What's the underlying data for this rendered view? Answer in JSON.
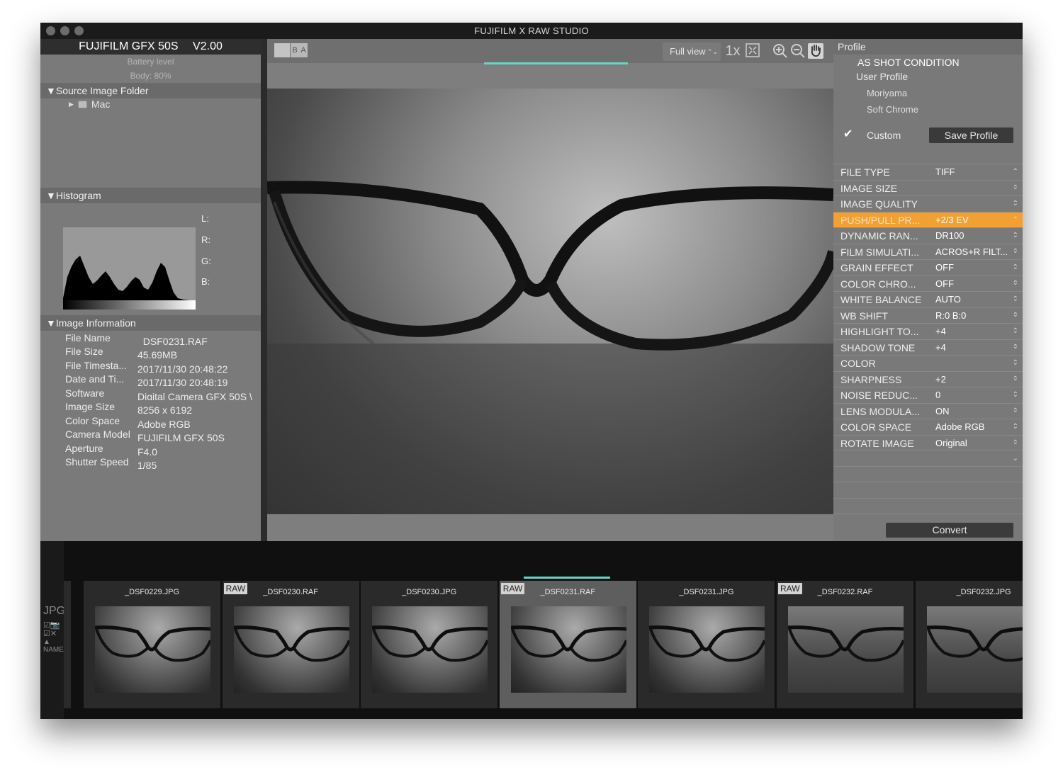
{
  "window": {
    "title": "FUJIFILM X RAW STUDIO"
  },
  "camera": {
    "model": "FUJIFILM GFX 50S",
    "version": "V2.00",
    "battery_label": "Battery level",
    "battery_body": "Body: 80%"
  },
  "source": {
    "header": "▼Source Image Folder",
    "item": "Mac"
  },
  "histogram": {
    "header": "▼Histogram",
    "labels": [
      "L:",
      "R:",
      "G:",
      "B:"
    ]
  },
  "info": {
    "header": "▼Image Information",
    "rows": [
      {
        "k": "File Name",
        "v": "_DSF0231.RAF"
      },
      {
        "k": "File Size",
        "v": "45.69MB"
      },
      {
        "k": "File Timesta...",
        "v": "2017/11/30 20:48:22"
      },
      {
        "k": "Date and Ti...",
        "v": "2017/11/30 20:48:19"
      },
      {
        "k": "Software",
        "v": "Digital Camera GFX 50S \\"
      },
      {
        "k": "Image Size",
        "v": "8256 x 6192"
      },
      {
        "k": "Color Space",
        "v": "Adobe RGB"
      },
      {
        "k": "Camera Model",
        "v": "FUJIFILM GFX 50S"
      },
      {
        "k": "Aperture",
        "v": "F4.0"
      },
      {
        "k": "Shutter Speed",
        "v": "1/85"
      }
    ]
  },
  "viewer": {
    "ba_b": "B",
    "ba_a": "A",
    "view_mode": "Full view",
    "zoom": "1x",
    "progress": 0.2
  },
  "profile": {
    "header": "Profile",
    "as_shot": "AS SHOT CONDITION",
    "user_profile": "User Profile",
    "items": [
      "Moriyama",
      "Soft Chrome"
    ],
    "custom": "Custom",
    "save_label": "Save Profile"
  },
  "settings": [
    {
      "k": "FILE TYPE",
      "v": "TIFF"
    },
    {
      "k": "IMAGE SIZE",
      "v": ""
    },
    {
      "k": "IMAGE QUALITY",
      "v": ""
    },
    {
      "k": "PUSH/PULL PR...",
      "v": "+2/3 EV"
    },
    {
      "k": "DYNAMIC RAN...",
      "v": "DR100"
    },
    {
      "k": "FILM SIMULATI...",
      "v": "ACROS+R FILT..."
    },
    {
      "k": "GRAIN EFFECT",
      "v": "OFF"
    },
    {
      "k": "COLOR CHRO...",
      "v": "OFF"
    },
    {
      "k": "WHITE BALANCE",
      "v": "AUTO"
    },
    {
      "k": "WB SHIFT",
      "v": "R:0 B:0"
    },
    {
      "k": "HIGHLIGHT TO...",
      "v": "+4"
    },
    {
      "k": "SHADOW TONE",
      "v": "+4"
    },
    {
      "k": "COLOR",
      "v": ""
    },
    {
      "k": "SHARPNESS",
      "v": "+2"
    },
    {
      "k": "NOISE REDUC...",
      "v": "0"
    },
    {
      "k": "LENS MODULA...",
      "v": "ON"
    },
    {
      "k": "COLOR SPACE",
      "v": "Adobe RGB"
    },
    {
      "k": "ROTATE IMAGE",
      "v": "Original"
    }
  ],
  "convert_label": "Convert",
  "filmstrip": {
    "side": {
      "jpg": "JPG",
      "name": "NAME"
    },
    "raw_badge": "RAW",
    "thumbs": [
      {
        "name": "_DSF0229.JPG",
        "raw": false
      },
      {
        "name": "_DSF0230.RAF",
        "raw": true
      },
      {
        "name": "_DSF0230.JPG",
        "raw": false
      },
      {
        "name": "_DSF0231.RAF",
        "raw": true
      },
      {
        "name": "_DSF0231.JPG",
        "raw": false
      },
      {
        "name": "_DSF0232.RAF",
        "raw": true
      },
      {
        "name": "_DSF0232.JPG",
        "raw": false
      }
    ]
  },
  "colors": {
    "accent": "#68d6c6",
    "active_row": "#f3a033"
  }
}
